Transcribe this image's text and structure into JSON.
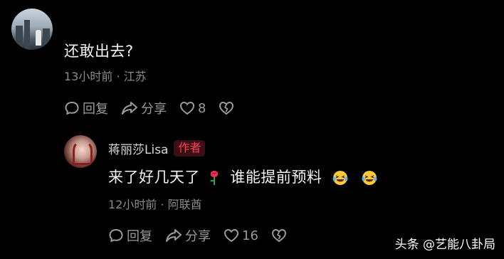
{
  "comment1": {
    "text": "还敢出去?",
    "meta": "13小时前 · 江苏",
    "reply_label": "回复",
    "share_label": "分享",
    "like_count": "8"
  },
  "comment2": {
    "author": "蒋丽莎Lisa",
    "author_badge": "作者",
    "text": "来了好几天了",
    "text_tail": "谁能提前预料",
    "meta": "12小时前 · 阿联酋",
    "reply_label": "回复",
    "share_label": "分享",
    "like_count": "16"
  },
  "watermark": "头条 @艺能八卦局",
  "icons": {
    "reply": "chat-bubble-icon",
    "share": "share-arrow-icon",
    "like": "heart-icon",
    "dislike": "broken-heart-icon",
    "rose": "rose-emoji-icon",
    "laugh": "laughing-emoji-icon"
  },
  "colors": {
    "background": "#000000",
    "author_badge": "#ff3b5c",
    "meta": "#8a8a8a",
    "action": "#9a9a9a"
  }
}
